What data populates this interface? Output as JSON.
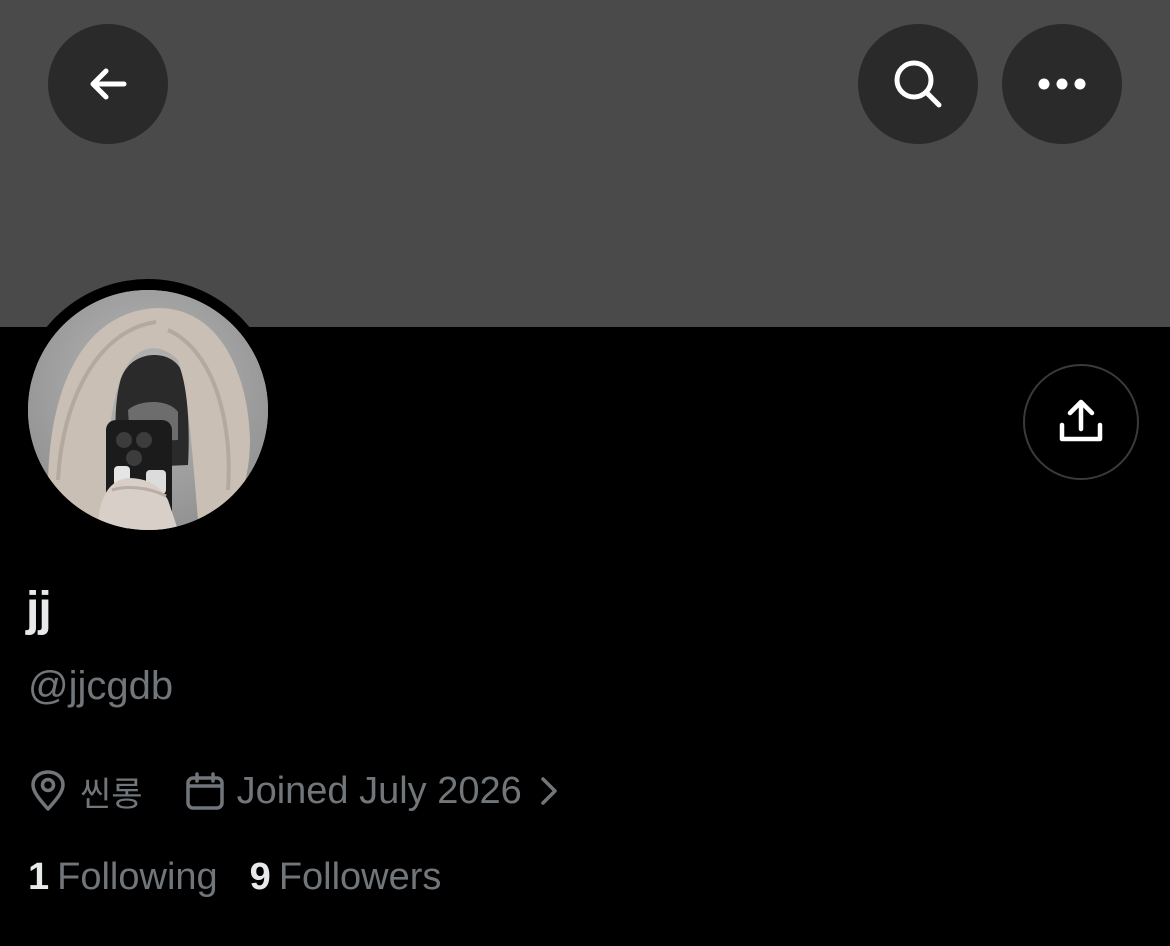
{
  "profile": {
    "display_name": "jj",
    "handle": "@jjcgdb",
    "location": "씬롱",
    "joined": "Joined July 2026",
    "following_count": "1",
    "following_label": "Following",
    "followers_count": "9",
    "followers_label": "Followers"
  },
  "icons": {
    "back": "arrow-left-icon",
    "search": "search-icon",
    "more": "more-horizontal-icon",
    "share": "share-upload-icon",
    "location": "location-pin-icon",
    "calendar": "calendar-icon",
    "chevron": "chevron-right-icon"
  },
  "colors": {
    "background": "#000000",
    "banner": "#4a4a4a",
    "button_bg": "#2a2a2a",
    "primary_text": "#e7e9ea",
    "secondary_text": "#71767b"
  }
}
